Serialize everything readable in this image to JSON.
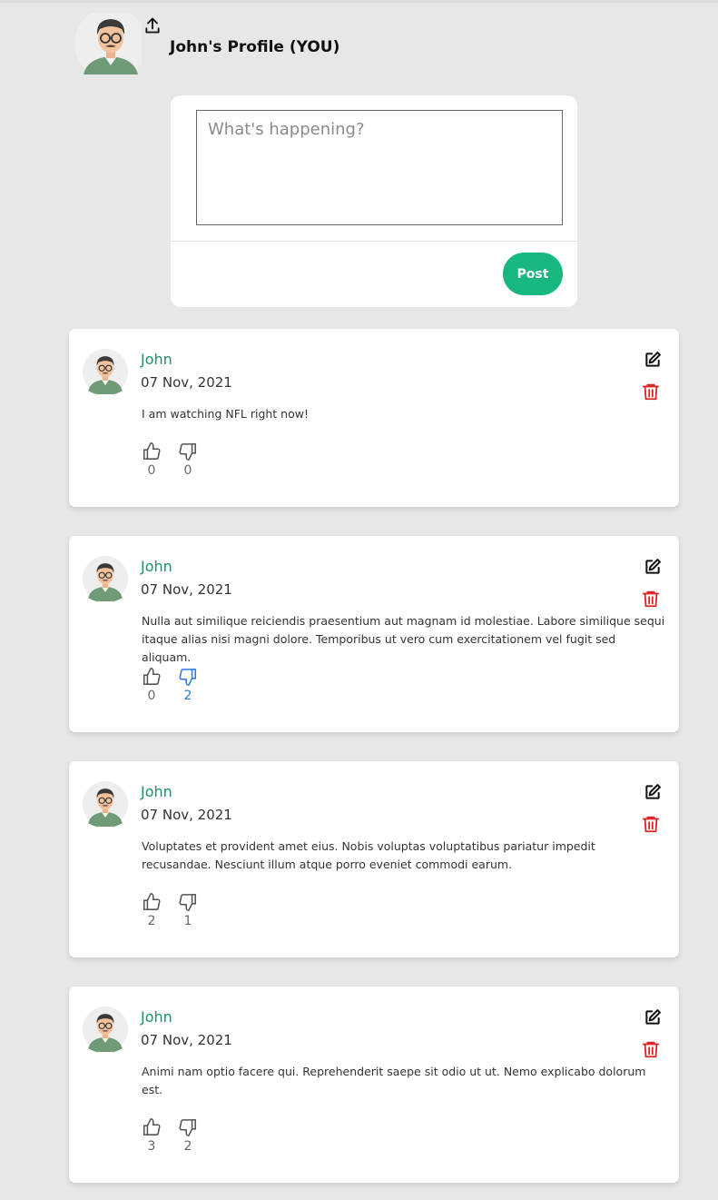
{
  "profile": {
    "title": "John's Profile (YOU)",
    "upload_icon": "upload-icon",
    "avatar": "user-avatar"
  },
  "composer": {
    "placeholder": "What's happening?",
    "value": "",
    "post_label": "Post"
  },
  "colors": {
    "accent": "#18b77e",
    "author": "#15946a",
    "danger": "#e02424",
    "active_vote": "#2d7be6",
    "background": "#e7e7e7"
  },
  "posts": [
    {
      "author": "John",
      "date": "07 Nov, 2021",
      "text": "I am watching NFL right now!",
      "likes": "0",
      "dislikes": "0",
      "disliked": false
    },
    {
      "author": "John",
      "date": "07 Nov, 2021",
      "text": "Nulla aut similique reiciendis praesentium aut magnam id molestiae. Labore similique sequi itaque alias nisi magni dolore. Temporibus ut vero cum exercitationem vel fugit sed aliquam.",
      "likes": "0",
      "dislikes": "2",
      "disliked": true
    },
    {
      "author": "John",
      "date": "07 Nov, 2021",
      "text": "Voluptates et provident amet eius. Nobis voluptas voluptatibus pariatur impedit recusandae. Nesciunt illum atque porro eveniet commodi earum.",
      "likes": "2",
      "dislikes": "1",
      "disliked": false
    },
    {
      "author": "John",
      "date": "07 Nov, 2021",
      "text": "Animi nam optio facere qui. Reprehenderit saepe sit odio ut ut. Nemo explicabo dolorum est.",
      "likes": "3",
      "dislikes": "2",
      "disliked": false
    }
  ]
}
